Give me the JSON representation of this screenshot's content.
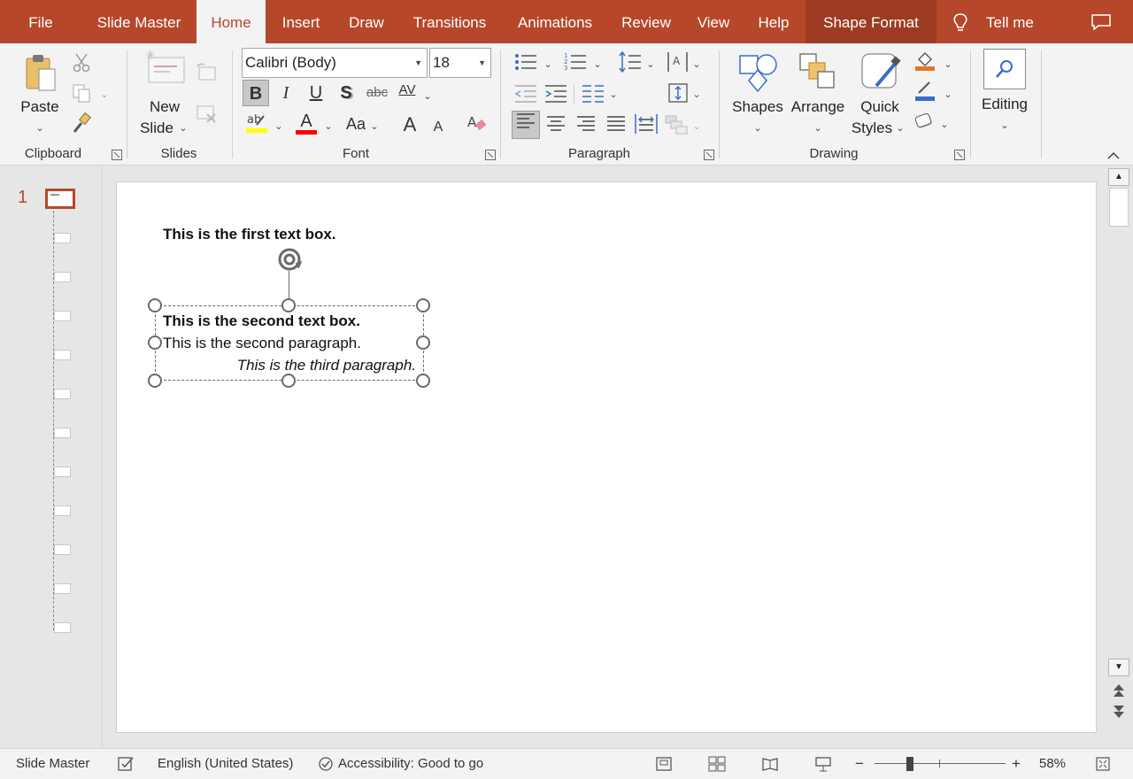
{
  "tabs": {
    "file": "File",
    "slide_master": "Slide Master",
    "home": "Home",
    "insert": "Insert",
    "draw": "Draw",
    "transitions": "Transitions",
    "animations": "Animations",
    "review": "Review",
    "view": "View",
    "help": "Help",
    "shape_format": "Shape Format",
    "tell_me": "Tell me"
  },
  "ribbon": {
    "clipboard": {
      "paste": "Paste",
      "group": "Clipboard"
    },
    "slides": {
      "new_slide_line1": "New",
      "new_slide_line2": "Slide",
      "group": "Slides"
    },
    "font": {
      "family": "Calibri (Body)",
      "size": "18",
      "bold": "B",
      "italic": "I",
      "underline": "U",
      "shadow": "S",
      "strike": "abc",
      "spacing": "AV",
      "font_color": "A",
      "change_case": "Aa",
      "grow": "A",
      "shrink": "A",
      "group": "Font"
    },
    "paragraph": {
      "group": "Paragraph"
    },
    "drawing": {
      "shapes": "Shapes",
      "arrange": "Arrange",
      "quick_styles_line1": "Quick",
      "quick_styles_line2": "Styles",
      "group": "Drawing"
    },
    "editing": {
      "label": "Editing"
    },
    "colors": {
      "highlight": "#ffff00",
      "font_color": "#ff0000",
      "fill": "#e8732b",
      "outline": "#3b6cc4"
    }
  },
  "thumbnails": {
    "slide_number": "1"
  },
  "slide": {
    "text_box_1": "This is the first text box.",
    "text_box_2": {
      "para1": "This is the second text box.",
      "para2": "This is the second paragraph.",
      "para3": "This is the third paragraph."
    }
  },
  "status": {
    "view_name": "Slide Master",
    "language": "English (United States)",
    "accessibility": "Accessibility: Good to go",
    "zoom_minus": "−",
    "zoom_plus": "+",
    "zoom_level": "58%"
  }
}
